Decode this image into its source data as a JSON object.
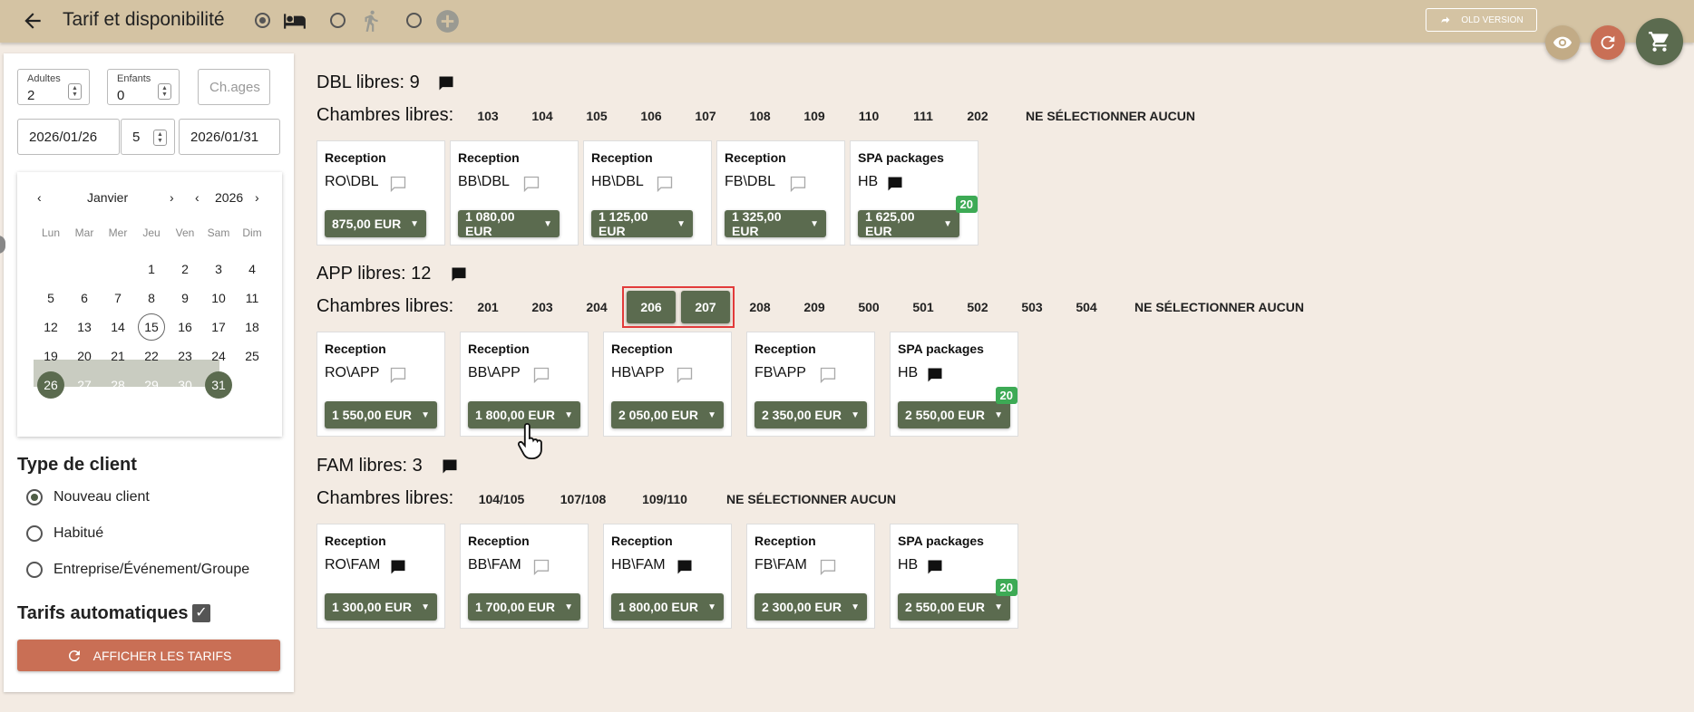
{
  "header": {
    "title": "Tarif et disponibilité",
    "old_version_label": "OLD VERSION",
    "mode_icons": [
      "bed-icon",
      "walking-icon",
      "add-icon"
    ]
  },
  "sidebar": {
    "adults_label": "Adultes",
    "adults_value": "2",
    "children_label": "Enfants",
    "children_value": "0",
    "ages_placeholder": "Ch.ages",
    "date_from": "2026/01/26",
    "nights": "5",
    "date_to": "2026/01/31",
    "calendar": {
      "month": "Janvier",
      "year": "2026",
      "weekdays": [
        "Lun",
        "Mar",
        "Mer",
        "Jeu",
        "Ven",
        "Sam",
        "Dim"
      ]
    },
    "client_type_title": "Type de client",
    "client_types": [
      "Nouveau client",
      "Habitué",
      "Entreprise/Événement/Groupe"
    ],
    "auto_rates_label": "Tarifs automatiques",
    "show_rates_button": "AFFICHER LES TARIFS"
  },
  "groups": [
    {
      "title": "DBL libres: 9",
      "rooms_label": "Chambres libres:",
      "rooms": [
        "103",
        "104",
        "105",
        "106",
        "107",
        "108",
        "109",
        "110",
        "111",
        "202"
      ],
      "none_label": "NE SÉLECTIONNER AUCUN",
      "cards": [
        {
          "title": "Reception",
          "code": "RO\\DBL",
          "price": "875,00 EUR"
        },
        {
          "title": "Reception",
          "code": "BB\\DBL",
          "price": "1 080,00 EUR"
        },
        {
          "title": "Reception",
          "code": "HB\\DBL",
          "price": "1 125,00 EUR"
        },
        {
          "title": "Reception",
          "code": "FB\\DBL",
          "price": "1 325,00 EUR"
        },
        {
          "title": "SPA packages",
          "code": "HB",
          "price": "1 625,00 EUR",
          "badge": "20"
        }
      ]
    },
    {
      "title": "APP libres: 12",
      "rooms_label": "Chambres libres:",
      "rooms": [
        "201",
        "203",
        "204",
        "206",
        "207",
        "208",
        "209",
        "500",
        "501",
        "502",
        "503",
        "504"
      ],
      "selected_rooms": [
        "206",
        "207"
      ],
      "none_label": "NE SÉLECTIONNER AUCUN",
      "cards": [
        {
          "title": "Reception",
          "code": "RO\\APP",
          "price": "1 550,00 EUR"
        },
        {
          "title": "Reception",
          "code": "BB\\APP",
          "price": "1 800,00 EUR"
        },
        {
          "title": "Reception",
          "code": "HB\\APP",
          "price": "2 050,00 EUR"
        },
        {
          "title": "Reception",
          "code": "FB\\APP",
          "price": "2 350,00 EUR"
        },
        {
          "title": "SPA packages",
          "code": "HB",
          "price": "2 550,00 EUR",
          "badge": "20"
        }
      ]
    },
    {
      "title": "FAM libres: 3",
      "rooms_label": "Chambres libres:",
      "rooms": [
        "104/105",
        "107/108",
        "109/110"
      ],
      "none_label": "NE SÉLECTIONNER AUCUN",
      "cards": [
        {
          "title": "Reception",
          "code": "RO\\FAM",
          "price": "1 300,00 EUR"
        },
        {
          "title": "Reception",
          "code": "BB\\FAM",
          "price": "1 700,00 EUR"
        },
        {
          "title": "Reception",
          "code": "HB\\FAM",
          "price": "1 800,00 EUR"
        },
        {
          "title": "Reception",
          "code": "FB\\FAM",
          "price": "2 300,00 EUR"
        },
        {
          "title": "SPA packages",
          "code": "HB",
          "price": "2 550,00 EUR",
          "badge": "20"
        }
      ]
    }
  ],
  "colors": {
    "header_bg": "#d4c3a3",
    "page_bg": "#f3ebe3",
    "accent_green": "#5b6b4f",
    "accent_orange": "#c96f55",
    "badge_green": "#3daa55",
    "highlight_red": "#e23b3b"
  }
}
